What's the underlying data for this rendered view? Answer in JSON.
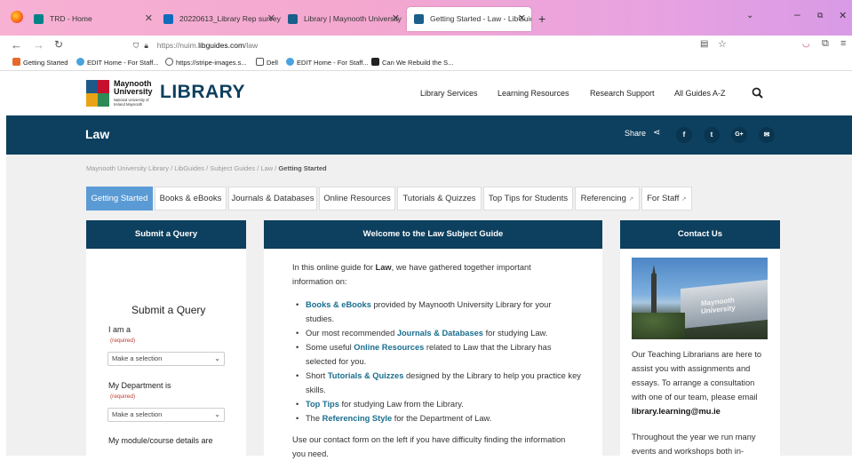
{
  "browser": {
    "tabs": [
      {
        "label": "TRD - Home",
        "active": false
      },
      {
        "label": "20220613_Library Rep survey fo",
        "active": false
      },
      {
        "label": "Library | Maynooth University",
        "active": false
      },
      {
        "label": "Getting Started - Law - LibGuid",
        "active": true
      }
    ],
    "new_tab": "+",
    "url_prefix": "https://nuim.",
    "url_domain": "libguides.com",
    "url_path": "/law",
    "bookmarks": [
      "Getting Started",
      "EDIT Home - For Staff...",
      "https://stripe-images.s...",
      "Dell",
      "EDIT Home - For Staff...",
      "Can We Rebuild the S..."
    ]
  },
  "site": {
    "logo_line1": "Maynooth",
    "logo_line2": "University",
    "logo_line3": "National University of Ireland Maynooth",
    "logo_word": "LIBRARY",
    "nav": [
      "Library Services",
      "Learning Resources",
      "Research Support",
      "All Guides A-Z"
    ],
    "guide_title": "Law",
    "share_label": "Share",
    "breadcrumb": [
      "Maynooth University Library",
      "LibGuides",
      "Subject Guides",
      "Law",
      "Getting Started"
    ],
    "subtabs": [
      "Getting Started",
      "Books & eBooks",
      "Journals & Databases",
      "Online Resources",
      "Tutorials & Quizzes",
      "Top Tips for Students",
      "Referencing",
      "For Staff"
    ]
  },
  "left_box": {
    "header": "Submit a Query",
    "form_title": "Submit a Query",
    "field1_label": "I am a",
    "field1_required": "(required)",
    "field1_value": "Make a selection",
    "field2_label": "My Department is",
    "field2_required": "(required)",
    "field2_value": "Make a selection",
    "field3_label": "My module/course details are"
  },
  "center_box": {
    "header": "Welcome to the Law Subject Guide",
    "intro_a": "In this online guide for ",
    "intro_bold": "Law",
    "intro_b": ", we have gathered together important",
    "intro_c": "information on:",
    "bullets": [
      {
        "link": "Books & eBooks",
        "pre": "",
        "post": " provided by Maynooth University Library for your",
        "cont": "studies."
      },
      {
        "link": "Journals & Databases",
        "pre": "Our most recommended ",
        "post": " for studying Law.",
        "cont": ""
      },
      {
        "link": "Online Resources",
        "pre": "Some useful ",
        "post": " related to Law that the Library has",
        "cont": "selected for you."
      },
      {
        "link": "Tutorials & Quizzes",
        "pre": "Short ",
        "post": " designed by the Library to help you practice key",
        "cont": "skills."
      },
      {
        "link": "Top Tips",
        "pre": "",
        "post": " for studying Law from the Library.",
        "cont": ""
      },
      {
        "link": "Referencing Style",
        "pre": "The ",
        "post": " for the Department of Law.",
        "cont": ""
      }
    ],
    "outro_1": "Use our contact form on the left if you have difficulty finding the information",
    "outro_2": "you need."
  },
  "right_box": {
    "header": "Contact Us",
    "photo_text": "Maynooth University",
    "p1_1": "Our Teaching Librarians are here to",
    "p1_2": "assist you with assignments and",
    "p1_3": "essays. To arrange a consultation",
    "p1_4": "with one of our team, please email",
    "email": "library.learning@mu.ie",
    "p2_1": "Throughout the year we run many",
    "p2_2": "events and workshops both in-"
  },
  "colors": {
    "navy": "#0d3f5e",
    "active_tab": "#5b9bd5",
    "link": "#1a6e8e"
  }
}
